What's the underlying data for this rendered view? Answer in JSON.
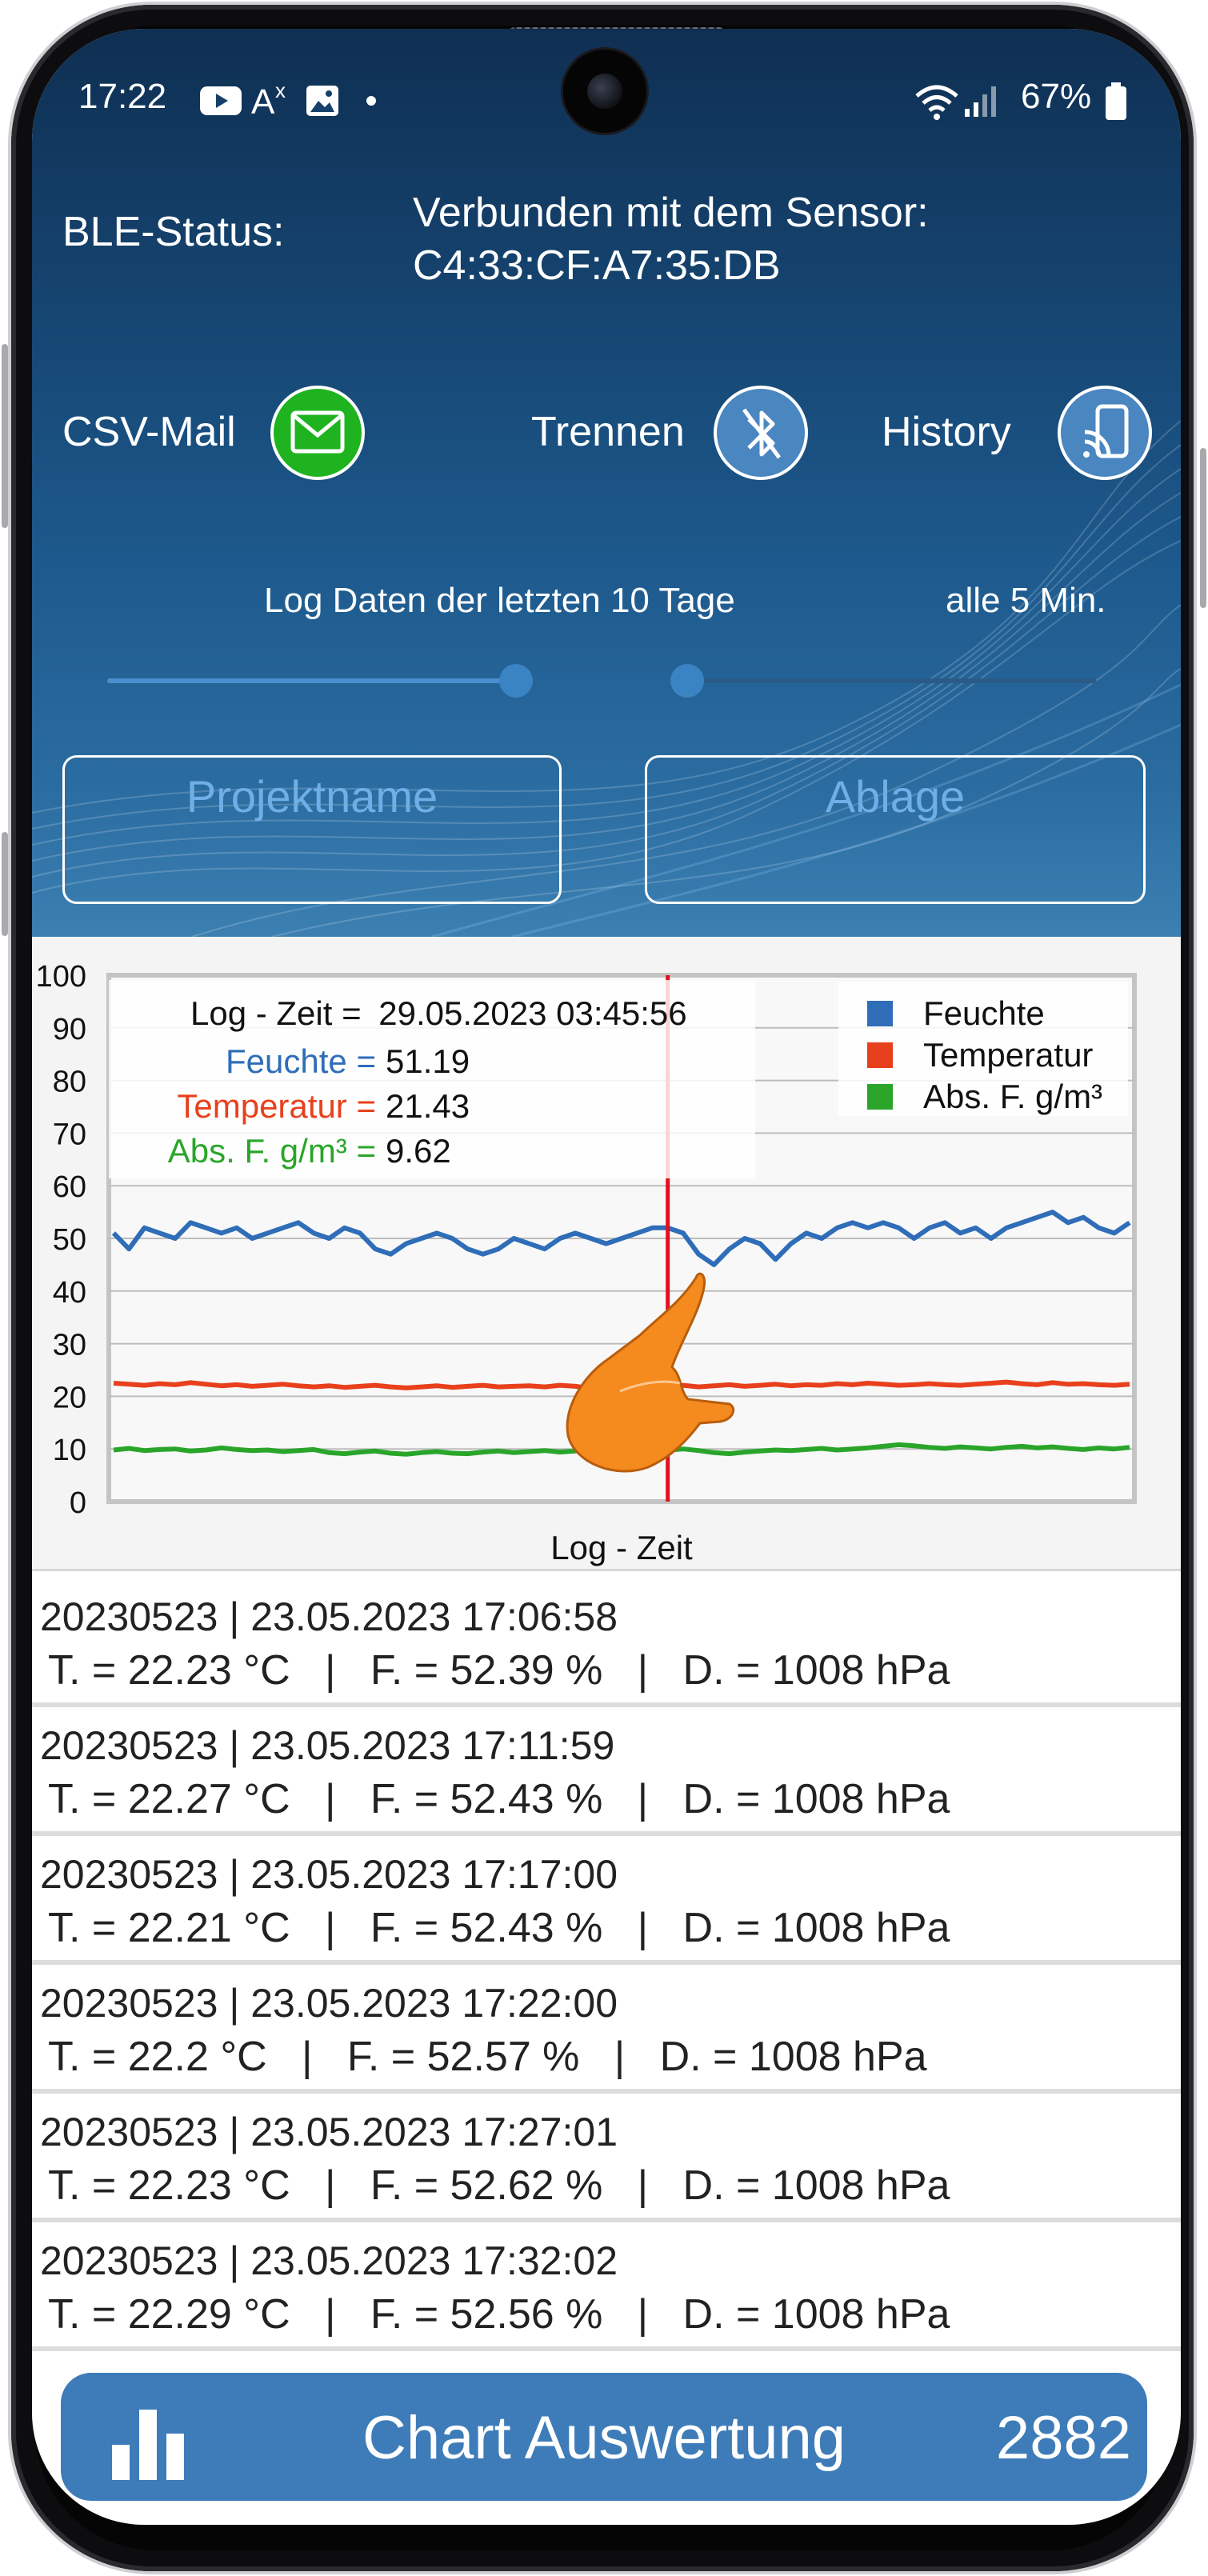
{
  "status_bar": {
    "time": "17:22",
    "notification_icons": [
      "youtube-icon",
      "translate-icon",
      "gallery-icon",
      "dot-icon"
    ],
    "battery_percent": "67%",
    "system_icons": [
      "wifi-icon",
      "signal-icon",
      "battery-icon"
    ]
  },
  "ble": {
    "label": "BLE-Status:",
    "status_line1": "Verbunden mit dem Sensor:",
    "status_line2": "C4:33:CF:A7:35:DB"
  },
  "actions": {
    "csv_mail": "CSV-Mail",
    "disconnect": "Trennen",
    "history": "History"
  },
  "log_settings": {
    "range_label": "Log Daten der letzten 10 Tage",
    "interval_label": "alle 5 Min.",
    "range_slider_fraction": 0.55,
    "interval_slider_fraction": 0.0
  },
  "fields": {
    "project_placeholder": "Projektname",
    "storage_placeholder": "Ablage"
  },
  "chart_data": {
    "type": "line",
    "xlabel": "Log - Zeit",
    "ylabel": "",
    "ylim": [
      0,
      100
    ],
    "yticks": [
      0,
      10,
      20,
      30,
      40,
      50,
      60,
      70,
      80,
      90,
      100
    ],
    "grid": true,
    "legend_position": "top-right",
    "cursor_fraction": 0.545,
    "tooltip": {
      "time_label": "Log - Zeit =",
      "time_value": "29.05.2023 03:45:56",
      "items": [
        {
          "label": "Feuchte =",
          "value": "51.19",
          "color": "#2f6db8"
        },
        {
          "label": "Temperatur =",
          "value": "21.43",
          "color": "#e8401c"
        },
        {
          "label": "Abs. F. g/m³ =",
          "value": "9.62",
          "color": "#2aa52a"
        }
      ]
    },
    "series": [
      {
        "name": "Feuchte",
        "color": "#2f6db8",
        "values": [
          51,
          48,
          52,
          51,
          50,
          53,
          52,
          51,
          52,
          50,
          51,
          52,
          53,
          51,
          50,
          52,
          51,
          48,
          47,
          49,
          50,
          51,
          50,
          48,
          47,
          48,
          50,
          49,
          48,
          50,
          51,
          50,
          49,
          50,
          51,
          52,
          52,
          51,
          47,
          45,
          48,
          50,
          49,
          46,
          49,
          51,
          50,
          52,
          53,
          52,
          53,
          52,
          50,
          52,
          53,
          51,
          52,
          50,
          52,
          53,
          54,
          55,
          53,
          54,
          52,
          51,
          53
        ]
      },
      {
        "name": "Temperatur",
        "color": "#e8401c",
        "values": [
          22.5,
          22.3,
          22.1,
          22.4,
          22.2,
          22.6,
          22.3,
          22.0,
          22.2,
          21.9,
          22.1,
          22.3,
          22.0,
          21.8,
          22.0,
          21.7,
          21.9,
          22.1,
          21.8,
          21.6,
          21.8,
          22.0,
          21.7,
          21.9,
          22.1,
          21.8,
          21.9,
          22.0,
          21.8,
          22.1,
          21.9,
          21.5,
          21.7,
          21.9,
          22.0,
          21.8,
          21.9,
          22.1,
          21.8,
          22.0,
          22.2,
          21.9,
          22.1,
          22.3,
          22.0,
          22.2,
          22.1,
          22.4,
          22.2,
          22.5,
          22.3,
          22.1,
          22.2,
          22.4,
          22.2,
          22.1,
          22.3,
          22.5,
          22.7,
          22.4,
          22.2,
          22.6,
          22.3,
          22.4,
          22.2,
          22.1,
          22.3
        ]
      },
      {
        "name": "Abs. F. g/m³",
        "color": "#2aa52a",
        "values": [
          9.8,
          10.1,
          9.7,
          9.9,
          10.0,
          9.6,
          9.8,
          10.2,
          9.9,
          9.7,
          9.8,
          9.5,
          9.7,
          9.9,
          9.3,
          9.1,
          9.4,
          9.6,
          9.2,
          9.0,
          9.3,
          9.5,
          9.2,
          9.1,
          9.4,
          9.6,
          9.3,
          9.5,
          9.7,
          9.4,
          9.6,
          9.8,
          9.5,
          9.7,
          9.9,
          9.6,
          9.8,
          10.0,
          9.7,
          9.3,
          9.1,
          9.4,
          9.6,
          9.8,
          9.7,
          9.9,
          10.1,
          9.8,
          10.0,
          10.2,
          10.5,
          10.8,
          10.6,
          10.3,
          10.1,
          10.4,
          10.2,
          10.0,
          10.3,
          10.5,
          10.2,
          10.4,
          10.1,
          9.9,
          10.2,
          10.0,
          10.3
        ]
      }
    ]
  },
  "log_entries": [
    {
      "header": "20230523 | 23.05.2023 17:06:58",
      "values": "T. = 22.23 °C   |   F. = 52.39 %   |   D. = 1008 hPa"
    },
    {
      "header": "20230523 | 23.05.2023 17:11:59",
      "values": "T. = 22.27 °C   |   F. = 52.43 %   |   D. = 1008 hPa"
    },
    {
      "header": "20230523 | 23.05.2023 17:17:00",
      "values": "T. = 22.21 °C   |   F. = 52.43 %   |   D. = 1008 hPa"
    },
    {
      "header": "20230523 | 23.05.2023 17:22:00",
      "values": "T. = 22.2 °C   |   F. = 52.57 %   |   D. = 1008 hPa"
    },
    {
      "header": "20230523 | 23.05.2023 17:27:01",
      "values": "T. = 22.23 °C   |   F. = 52.62 %   |   D. = 1008 hPa"
    },
    {
      "header": "20230523 | 23.05.2023 17:32:02",
      "values": "T. = 22.29 °C   |   F. = 52.56 %   |   D. = 1008 hPa"
    }
  ],
  "chart_button": {
    "label": "Chart Auswertung",
    "count": "2882"
  },
  "colors": {
    "accent": "#3d7cb8",
    "mail_button": "#1fb31f",
    "cursor": "#e0101e"
  }
}
